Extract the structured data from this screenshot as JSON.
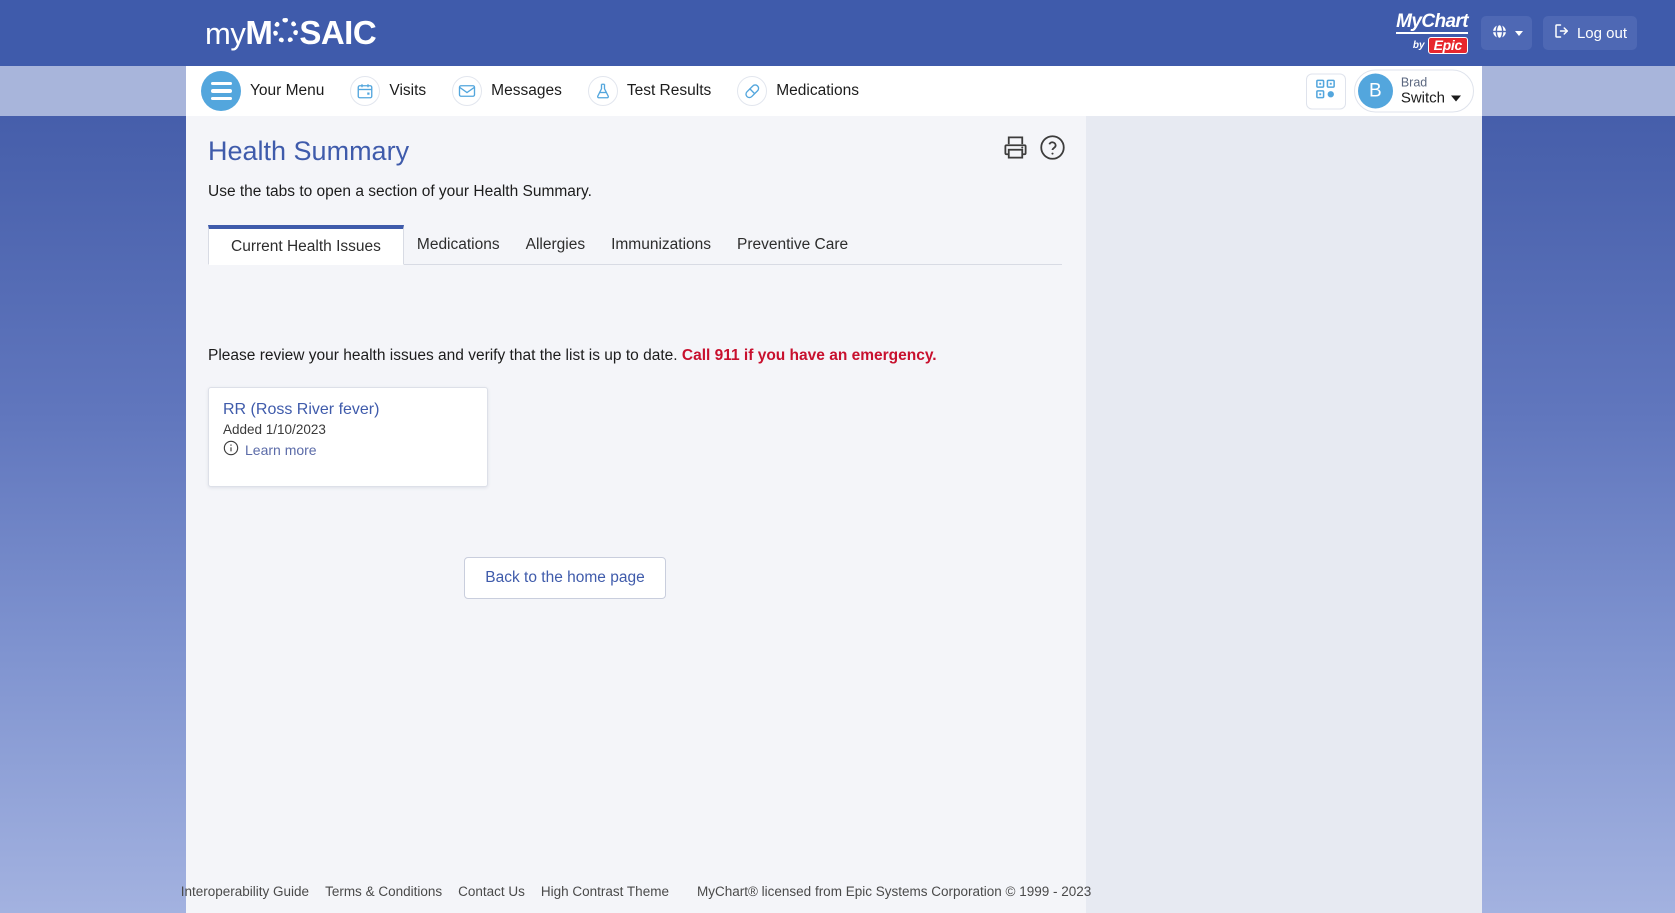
{
  "header": {
    "logo_my": "my",
    "logo_mosaic_pre": "M",
    "logo_mosaic_post": "SAIC",
    "mychart_brand_top": "MyChart",
    "mychart_brand_by": "by",
    "mychart_brand_epic": "Epic",
    "language_icon": "globe-icon",
    "logout_label": "Log out",
    "logout_icon": "sign-out-icon"
  },
  "nav": {
    "menu_label": "Your Menu",
    "items": [
      {
        "label": "Visits",
        "icon": "calendar-icon"
      },
      {
        "label": "Messages",
        "icon": "envelope-icon"
      },
      {
        "label": "Test Results",
        "icon": "flask-icon"
      },
      {
        "label": "Medications",
        "icon": "pill-icon"
      }
    ],
    "qr_icon": "qr-code-icon",
    "user_name": "Brad",
    "user_initial": "B",
    "switch_label": "Switch"
  },
  "page": {
    "title": "Health Summary",
    "subtitle": "Use the tabs to open a section of your Health Summary.",
    "print_icon": "printer-icon",
    "help_icon": "help-circle-icon"
  },
  "tabs": [
    {
      "label": "Current Health Issues",
      "active": true
    },
    {
      "label": "Medications",
      "active": false
    },
    {
      "label": "Allergies",
      "active": false
    },
    {
      "label": "Immunizations",
      "active": false
    },
    {
      "label": "Preventive Care",
      "active": false
    }
  ],
  "notice": {
    "text": "Please review your health issues and verify that the list is up to date.",
    "emergency": "Call 911 if you have an emergency."
  },
  "issues": [
    {
      "name": "RR (Ross River fever)",
      "added": "Added 1/10/2023",
      "learn_more": "Learn more",
      "info_icon": "info-circle-icon"
    }
  ],
  "home_button": "Back to the home page",
  "footer": {
    "links": [
      "Interoperability Guide",
      "Terms & Conditions",
      "Contact Us",
      "High Contrast Theme"
    ],
    "copyright": "MyChart® licensed from Epic Systems Corporation © 1999 - 2023"
  },
  "colors": {
    "header_blue": "#3f5bab",
    "accent_blue": "#53a6dd",
    "emergency_red": "#c8102e",
    "link_blue": "#3f5bab"
  }
}
